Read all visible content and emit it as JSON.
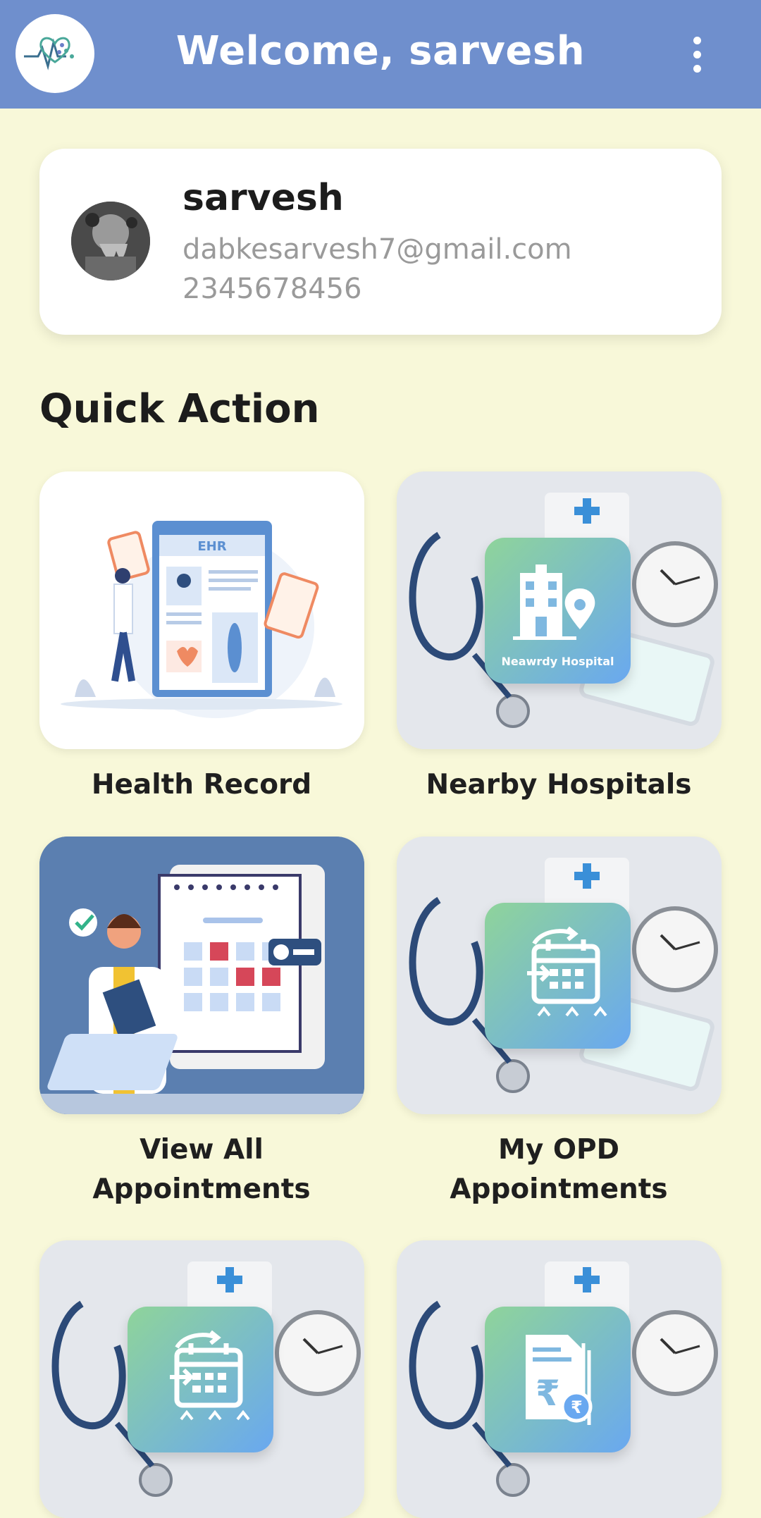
{
  "app_bar": {
    "title": "Welcome, sarvesh",
    "logo_icon": "heartbeat-logo-icon",
    "menu_icon": "more-vertical-icon",
    "color": "#6f8fcd"
  },
  "profile": {
    "name": "sarvesh",
    "email": "dabkesarvesh7@gmail.com",
    "phone": "2345678456"
  },
  "quick_action": {
    "title": "Quick Action",
    "tiles": [
      {
        "label": "Health Record",
        "icon": "ehr-illustration-icon"
      },
      {
        "label": "Nearby Hospitals",
        "icon": "hospital-location-icon",
        "badge_text": "Neawrdy Hospital"
      },
      {
        "label_line1": "View All",
        "label_line2": "Appointments",
        "icon": "doctor-calendar-illustration-icon"
      },
      {
        "label_line1": "My OPD",
        "label_line2": "Appointments",
        "icon": "calendar-appointment-icon"
      },
      {
        "label": "",
        "icon": "calendar-appointment-icon"
      },
      {
        "label": "",
        "icon": "rupee-bill-icon"
      }
    ]
  },
  "colors": {
    "background": "#f8f8d9",
    "card": "#ffffff",
    "text_dark": "#1c1c1c",
    "text_muted": "#9a9a9a"
  }
}
